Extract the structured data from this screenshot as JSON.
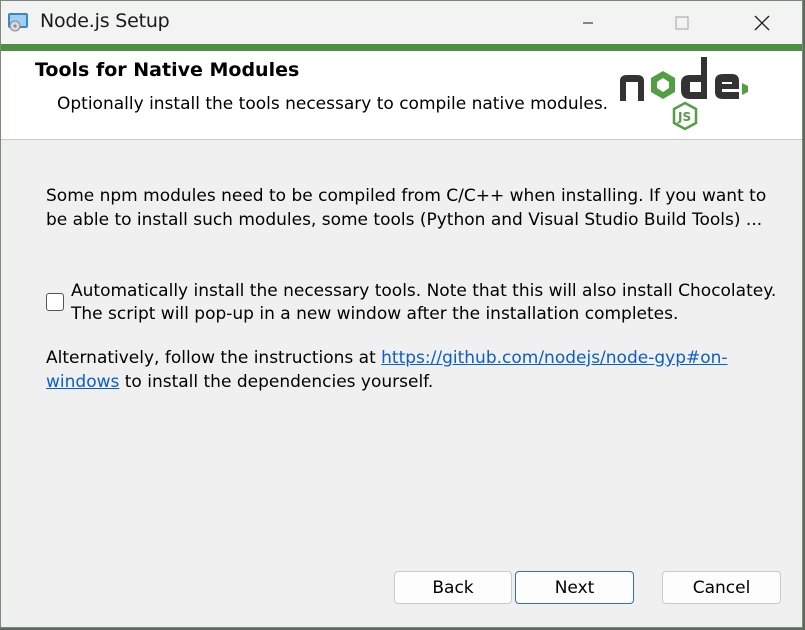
{
  "window": {
    "title": "Node.js Setup"
  },
  "banner": {
    "title": "Tools for Native Modules",
    "subtitle": "Optionally install the tools necessary to compile native modules."
  },
  "content": {
    "intro": "Some npm modules need to be compiled from C/C++ when installing. If you want to be able to install such modules, some tools (Python and Visual Studio Build Tools) ...",
    "checkbox_label": "Automatically install the necessary tools. Note that this will also install Chocolatey. The script will pop-up in a new window after the installation completes.",
    "checkbox_checked": false,
    "alt_prefix": "Alternatively, follow the instructions at ",
    "alt_link": "https://github.com/nodejs/node-gyp#on-windows",
    "alt_suffix": " to install the dependencies yourself."
  },
  "buttons": {
    "back": "Back",
    "next": "Next",
    "cancel": "Cancel"
  },
  "colors": {
    "accent": "#4d8f43",
    "link": "#0b5ec7",
    "logo_dark": "#333333",
    "logo_green": "#539e43"
  }
}
